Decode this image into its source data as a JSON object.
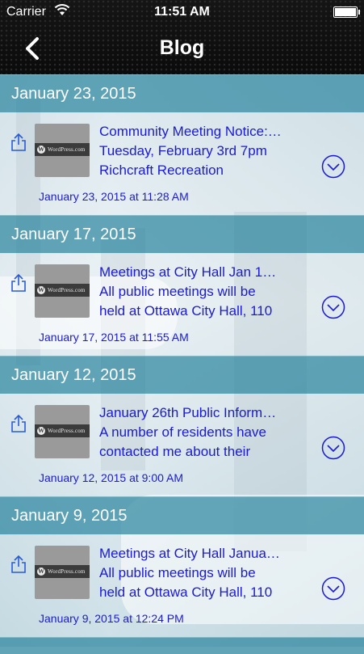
{
  "status_bar": {
    "carrier": "Carrier",
    "time": "11:51 AM"
  },
  "nav": {
    "title": "Blog"
  },
  "sections": [
    {
      "header": "January 23, 2015",
      "post": {
        "title": "Community Meeting Notice:…",
        "line1": "Tuesday, February 3rd  7pm",
        "line2": "Richcraft Recreation",
        "date": "January 23, 2015 at 11:28 AM",
        "thumb_text": "WordPress.com"
      }
    },
    {
      "header": "January 17, 2015",
      "post": {
        "title": "Meetings at City Hall Jan 1…",
        "line1": "All public meetings will be",
        "line2": "held at Ottawa City Hall, 110",
        "date": "January 17, 2015 at 11:55 AM",
        "thumb_text": "WordPress.com"
      }
    },
    {
      "header": "January 12, 2015",
      "post": {
        "title": "January 26th Public Inform…",
        "line1": "A number of residents have",
        "line2": "contacted me about their",
        "date": "January 12, 2015 at 9:00 AM",
        "thumb_text": "WordPress.com"
      }
    },
    {
      "header": "January 9, 2015",
      "post": {
        "title": "Meetings at City Hall Janua…",
        "line1": "All public meetings will be",
        "line2": "held at Ottawa City Hall, 110",
        "date": "January 9, 2015 at 12:24 PM",
        "thumb_text": "WordPress.com"
      }
    }
  ],
  "colors": {
    "link_text": "#1a1ad6",
    "section_header": "#4896ac",
    "topbar": "#111111"
  },
  "icons": [
    "back-chevron-icon",
    "share-icon",
    "chevron-down-circle-icon",
    "wifi-icon",
    "battery-icon"
  ]
}
